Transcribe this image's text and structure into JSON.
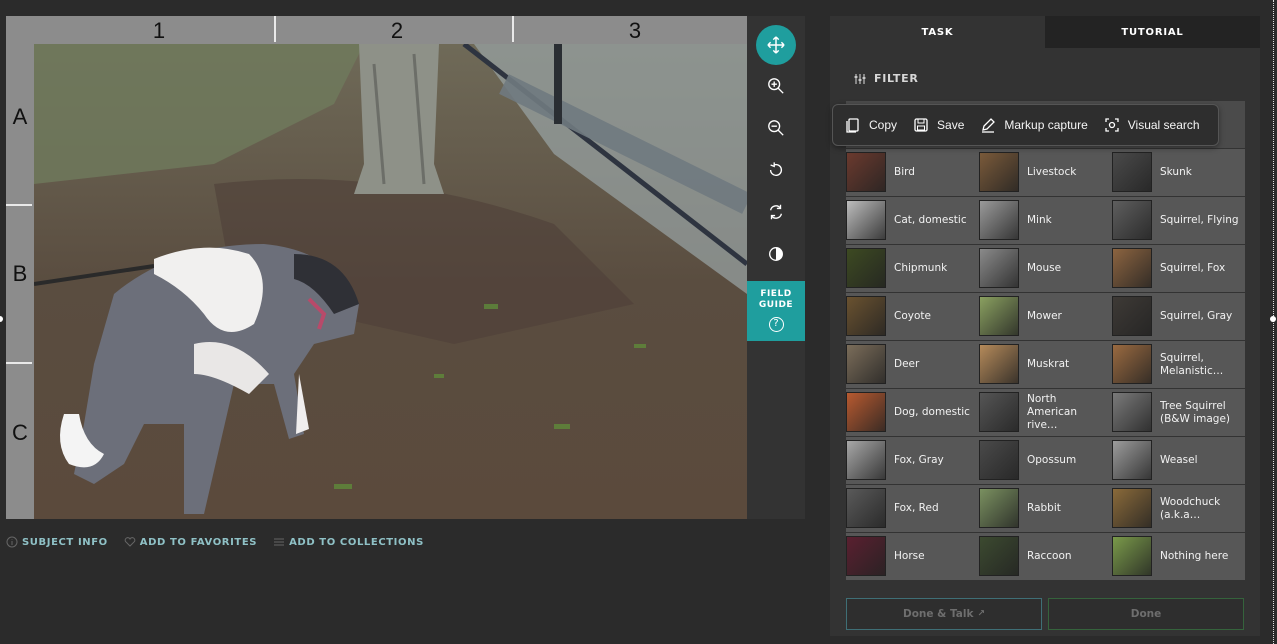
{
  "viewer": {
    "columns": [
      "1",
      "2",
      "3"
    ],
    "rows": [
      "A",
      "B",
      "C"
    ],
    "photo_alt": "Dog on a leash in a park with tree and chain-link fence"
  },
  "tools": {
    "move": "move-icon",
    "zoom_in": "zoom-in-icon",
    "zoom_out": "zoom-out-icon",
    "rotate": "rotate-icon",
    "reset": "reset-icon",
    "invert": "contrast-icon",
    "field_guide_line1": "FIELD",
    "field_guide_line2": "GUIDE",
    "field_guide_icon": "?"
  },
  "meta_bar": {
    "subject_info": "SUBJECT INFO",
    "add_to_favorites": "ADD TO FAVORITES",
    "add_to_collections": "ADD TO COLLECTIONS"
  },
  "panel": {
    "tabs": [
      "TASK",
      "TUTORIAL"
    ],
    "filter_label": "FILTER",
    "species": [
      {
        "name": "Bird",
        "color": "#6b3a2e"
      },
      {
        "name": "Livestock",
        "color": "#7a5a3a"
      },
      {
        "name": "Skunk",
        "color": "#4a4a4a"
      },
      {
        "name": "Cat, domestic",
        "color": "#bdbdbd"
      },
      {
        "name": "Mink",
        "color": "#9a9a9a"
      },
      {
        "name": "Squirrel, Flying",
        "color": "#5e5e5e"
      },
      {
        "name": "Chipmunk",
        "color": "#3d4a22"
      },
      {
        "name": "Mouse",
        "color": "#8a8a8a"
      },
      {
        "name": "Squirrel, Fox",
        "color": "#8c6440"
      },
      {
        "name": "Coyote",
        "color": "#6a5230"
      },
      {
        "name": "Mower",
        "color": "#8aa060"
      },
      {
        "name": "Squirrel, Gray",
        "color": "#3e3a36"
      },
      {
        "name": "Deer",
        "color": "#7b6d5a"
      },
      {
        "name": "Muskrat",
        "color": "#b58a5a"
      },
      {
        "name": "Squirrel, Melanistic…",
        "color": "#9a6a40"
      },
      {
        "name": "Dog, domestic",
        "color": "#b85a30"
      },
      {
        "name": "North American rive…",
        "color": "#555555"
      },
      {
        "name": "Tree Squirrel (B&W image)",
        "color": "#7a7a7a"
      },
      {
        "name": "Fox, Gray",
        "color": "#a8a8a8"
      },
      {
        "name": "Opossum",
        "color": "#4a4a4a"
      },
      {
        "name": "Weasel",
        "color": "#9c9c9c"
      },
      {
        "name": "Fox, Red",
        "color": "#5a5a5a"
      },
      {
        "name": "Rabbit",
        "color": "#7a9060"
      },
      {
        "name": "Woodchuck (a.k.a…",
        "color": "#8a6a3a"
      },
      {
        "name": "Horse",
        "color": "#5a2030"
      },
      {
        "name": "Raccoon",
        "color": "#3c4a30"
      },
      {
        "name": "Nothing here",
        "color": "#7a9a4a"
      }
    ],
    "done_talk_label": "Done & Talk",
    "done_label": "Done"
  },
  "context_menu": {
    "copy": "Copy",
    "save": "Save",
    "markup": "Markup capture",
    "visual_search": "Visual search"
  }
}
